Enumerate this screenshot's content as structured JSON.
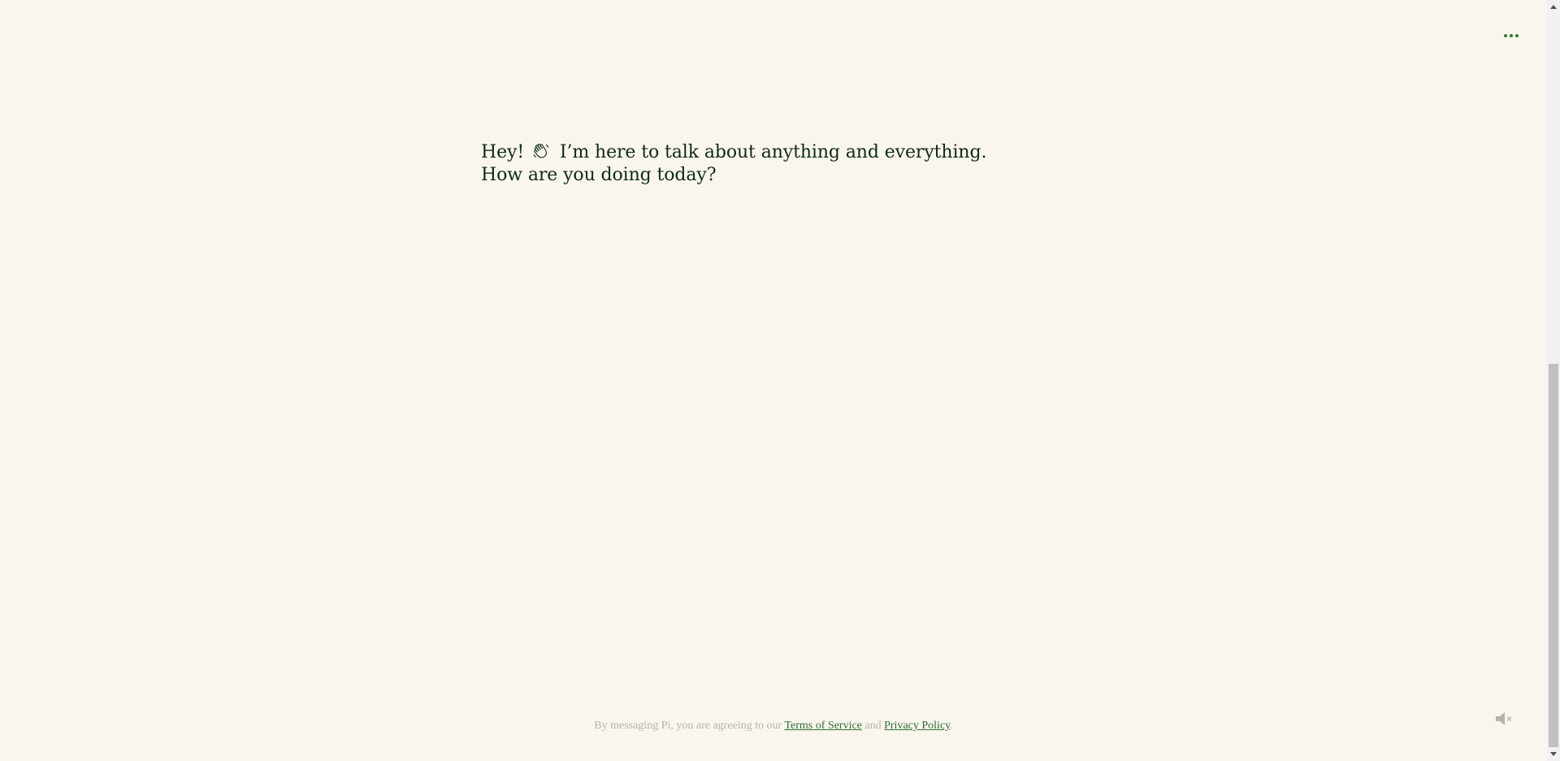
{
  "header": {
    "menu_icon": "more-horizontal-icon"
  },
  "conversation": {
    "greeting_prefix": "Hey!",
    "greeting_icon": "waving-hand-icon",
    "greeting_text": "I’m here to talk about anything and everything. How are you doing today?"
  },
  "footer": {
    "prefix": "By messaging Pi, you are agreeing to our ",
    "terms_link": "Terms of Service",
    "conjunction": " and ",
    "privacy_link": "Privacy Policy",
    "suffix": "."
  },
  "controls": {
    "sound_icon": "speaker-muted-icon"
  },
  "colors": {
    "background": "#faf6ee",
    "accent": "#2f7d32",
    "text": "#0e2a17",
    "muted_text": "#b8b3ab"
  }
}
